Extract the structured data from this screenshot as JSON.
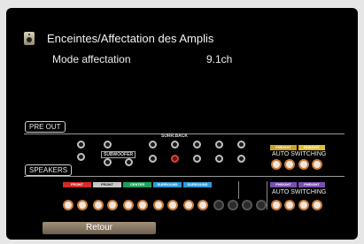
{
  "header": {
    "title": "Enceintes/Affectation des Amplis",
    "icon": "speaker-icon"
  },
  "setting": {
    "label": "Mode affectation",
    "value": "9.1ch"
  },
  "diagram": {
    "pre_out_label": "PRE OUT",
    "speakers_label": "SPEAKERS",
    "surr_back_label": "SURR.BACK",
    "subwoofer_label": "SUBWOOFER",
    "auto_switching_top": "AUTO SWITCHING",
    "auto_switching_bottom": "AUTO SWITCHING",
    "channels": [
      {
        "label": "FRONT",
        "color": "#d42a2a"
      },
      {
        "label": "FRONT",
        "color": "#c8c8c8"
      },
      {
        "label": "CENTER",
        "color": "#1aa35a"
      },
      {
        "label": "SURROUND",
        "color": "#2d9ad8"
      },
      {
        "label": "SURROUND",
        "color": "#2d9ad8"
      },
      {
        "label": "FHEIGHT",
        "color": "#7a4fb0"
      },
      {
        "label": "FHEIGHT",
        "color": "#7a4fb0"
      }
    ],
    "height_top": [
      {
        "label": "FHEIGHT",
        "color": "#c9a22a"
      },
      {
        "label": "RHEIGHT",
        "color": "#e0c030"
      }
    ]
  },
  "footer": {
    "back_label": "Retour"
  }
}
